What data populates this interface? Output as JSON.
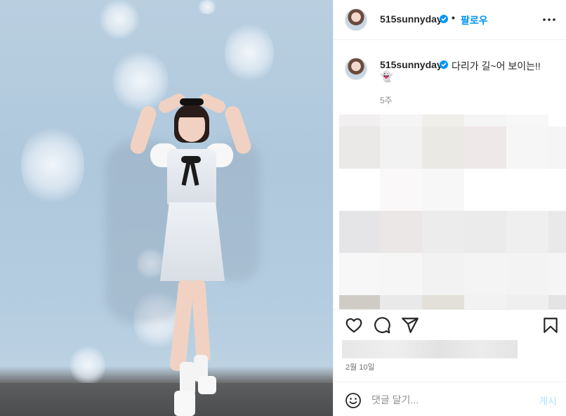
{
  "post": {
    "username": "515sunnyday",
    "follow_label": "팔로우",
    "separator": "•",
    "more_icon": "more-horizontal-icon",
    "caption_text": "다리가 길~어 보이는!!",
    "caption_emoji": "👻",
    "relative_time": "5주",
    "date": "2월 10일",
    "verified_icon": "verified-badge-icon",
    "accent_color": "#0095f6"
  },
  "actions": {
    "icons": [
      "heart-icon",
      "comment-icon",
      "share-icon",
      "bookmark-icon"
    ]
  },
  "comment_box": {
    "placeholder": "댓글 달기...",
    "post_label": "게시",
    "emoji_icon": "emoji-smile-icon"
  }
}
